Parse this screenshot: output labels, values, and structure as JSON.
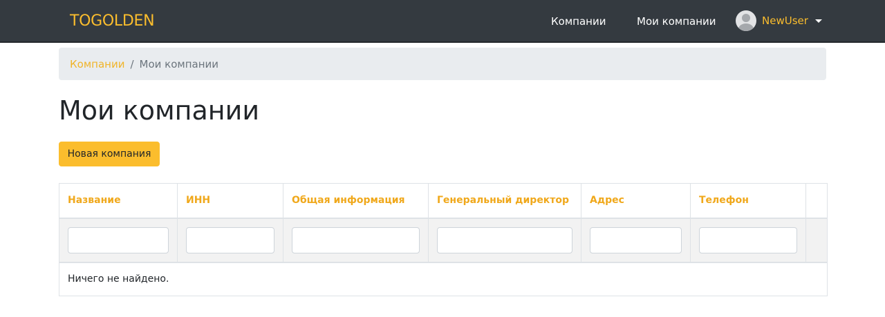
{
  "navbar": {
    "brand": "TOGOLDEN",
    "links": [
      "Компании",
      "Мои компании"
    ],
    "user": {
      "name": "NewUser",
      "avatar_icon": "user-avatar-icon"
    }
  },
  "breadcrumb": {
    "items": [
      "Компании",
      "Мои компании"
    ],
    "separator": "/"
  },
  "page": {
    "title": "Мои компании",
    "new_button_label": "Новая компания"
  },
  "table": {
    "columns": [
      "Название",
      "ИНН",
      "Общая информация",
      "Генеральный директор",
      "Адрес",
      "Телефон"
    ],
    "filters": [
      "",
      "",
      "",
      "",
      "",
      ""
    ],
    "empty_text": "Ничего не найдено."
  },
  "colors": {
    "navbar_bg": "#343a40",
    "accent": "#fbbd2d",
    "header_text": "#f0a81b",
    "breadcrumb_bg": "#e9ecef",
    "filter_row_bg": "#f2f2f2"
  }
}
